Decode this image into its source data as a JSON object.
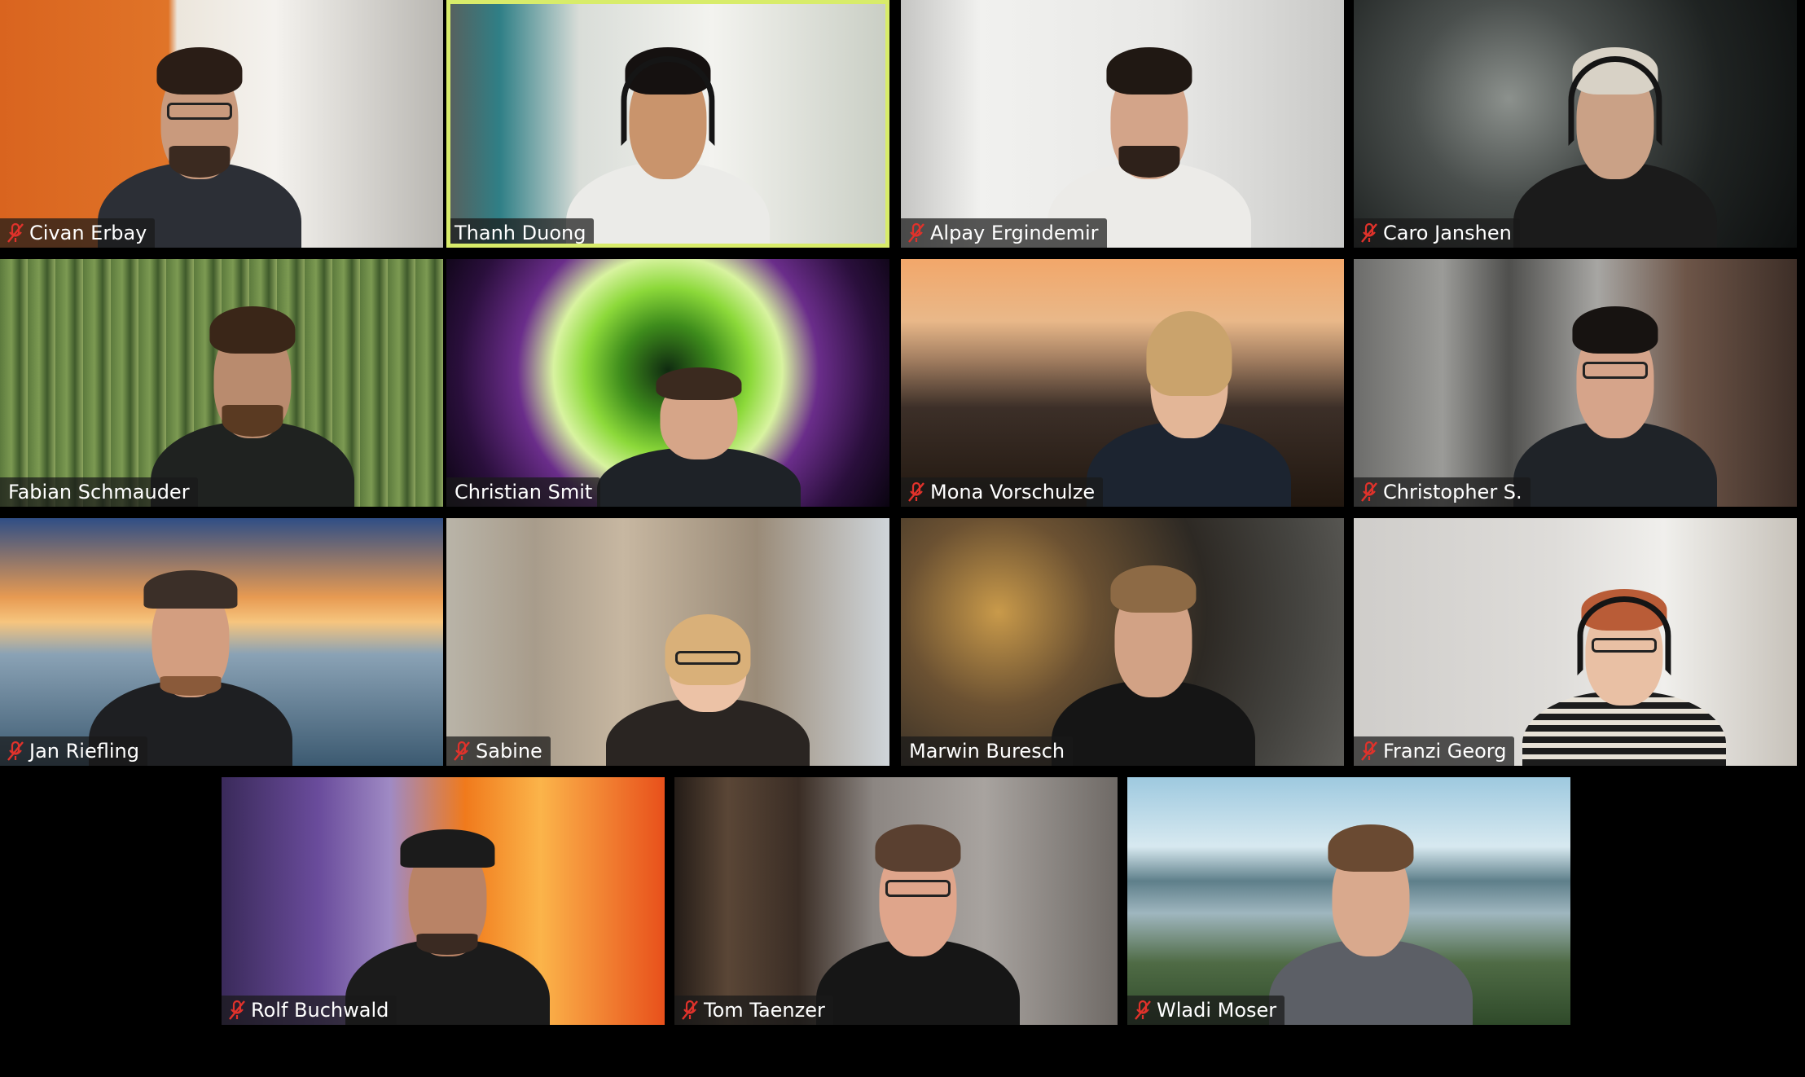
{
  "app": {
    "view": "gallery",
    "active_speaker": "Thanh Duong"
  },
  "icons": {
    "muted": "muted-microphone-icon"
  },
  "colors": {
    "active_speaker_border": "#d8ec6a",
    "mute_icon": "#e0322b",
    "nameplate_bg": "#191919",
    "name_text": "#ffffff",
    "background": "#000000"
  },
  "participants": [
    {
      "name": "Civan Erbay",
      "muted": true,
      "active": false
    },
    {
      "name": "Thanh Duong",
      "muted": false,
      "active": true
    },
    {
      "name": "Alpay Ergindemir",
      "muted": true,
      "active": false
    },
    {
      "name": "Caro Janshen",
      "muted": true,
      "active": false
    },
    {
      "name": "Fabian Schmauder",
      "muted": false,
      "active": false
    },
    {
      "name": "Christian Smit",
      "muted": false,
      "active": false
    },
    {
      "name": "Mona Vorschulze",
      "muted": true,
      "active": false
    },
    {
      "name": "Christopher S.",
      "muted": true,
      "active": false
    },
    {
      "name": "Jan Riefling",
      "muted": true,
      "active": false
    },
    {
      "name": "Sabine",
      "muted": true,
      "active": false
    },
    {
      "name": "Marwin Buresch",
      "muted": false,
      "active": false
    },
    {
      "name": "Franzi Georg",
      "muted": true,
      "active": false
    },
    {
      "name": "Rolf Buchwald",
      "muted": true,
      "active": false
    },
    {
      "name": "Tom Taenzer",
      "muted": true,
      "active": false
    },
    {
      "name": "Wladi Moser",
      "muted": true,
      "active": false
    }
  ]
}
